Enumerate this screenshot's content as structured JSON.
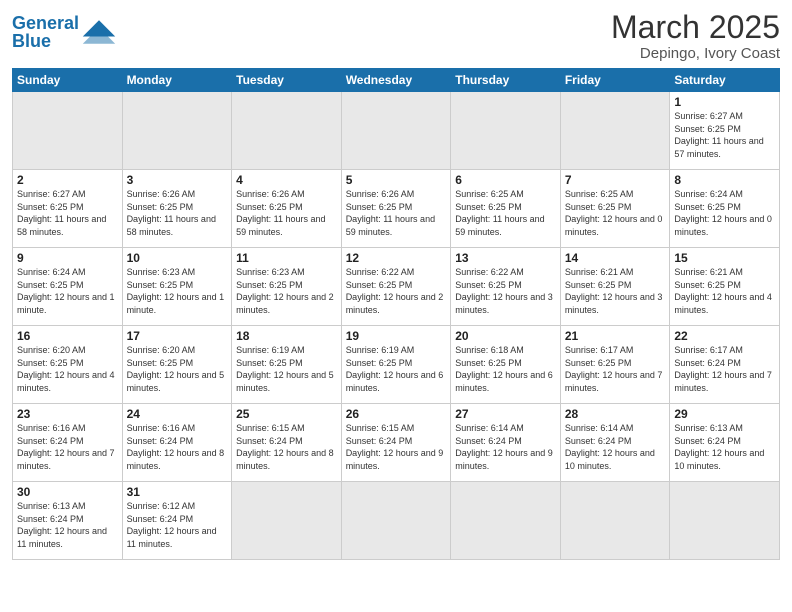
{
  "header": {
    "logo_general": "General",
    "logo_blue": "Blue",
    "month_year": "March 2025",
    "location": "Depingo, Ivory Coast"
  },
  "weekdays": [
    "Sunday",
    "Monday",
    "Tuesday",
    "Wednesday",
    "Thursday",
    "Friday",
    "Saturday"
  ],
  "weeks": [
    [
      {
        "day": "",
        "empty": true
      },
      {
        "day": "",
        "empty": true
      },
      {
        "day": "",
        "empty": true
      },
      {
        "day": "",
        "empty": true
      },
      {
        "day": "",
        "empty": true
      },
      {
        "day": "",
        "empty": true
      },
      {
        "day": "1",
        "sunrise": "6:27 AM",
        "sunset": "6:25 PM",
        "daylight": "11 hours and 57 minutes."
      }
    ],
    [
      {
        "day": "2",
        "sunrise": "6:27 AM",
        "sunset": "6:25 PM",
        "daylight": "11 hours and 58 minutes."
      },
      {
        "day": "3",
        "sunrise": "6:26 AM",
        "sunset": "6:25 PM",
        "daylight": "11 hours and 58 minutes."
      },
      {
        "day": "4",
        "sunrise": "6:26 AM",
        "sunset": "6:25 PM",
        "daylight": "11 hours and 59 minutes."
      },
      {
        "day": "5",
        "sunrise": "6:26 AM",
        "sunset": "6:25 PM",
        "daylight": "11 hours and 59 minutes."
      },
      {
        "day": "6",
        "sunrise": "6:25 AM",
        "sunset": "6:25 PM",
        "daylight": "11 hours and 59 minutes."
      },
      {
        "day": "7",
        "sunrise": "6:25 AM",
        "sunset": "6:25 PM",
        "daylight": "12 hours and 0 minutes."
      },
      {
        "day": "8",
        "sunrise": "6:24 AM",
        "sunset": "6:25 PM",
        "daylight": "12 hours and 0 minutes."
      }
    ],
    [
      {
        "day": "9",
        "sunrise": "6:24 AM",
        "sunset": "6:25 PM",
        "daylight": "12 hours and 1 minute."
      },
      {
        "day": "10",
        "sunrise": "6:23 AM",
        "sunset": "6:25 PM",
        "daylight": "12 hours and 1 minute."
      },
      {
        "day": "11",
        "sunrise": "6:23 AM",
        "sunset": "6:25 PM",
        "daylight": "12 hours and 2 minutes."
      },
      {
        "day": "12",
        "sunrise": "6:22 AM",
        "sunset": "6:25 PM",
        "daylight": "12 hours and 2 minutes."
      },
      {
        "day": "13",
        "sunrise": "6:22 AM",
        "sunset": "6:25 PM",
        "daylight": "12 hours and 3 minutes."
      },
      {
        "day": "14",
        "sunrise": "6:21 AM",
        "sunset": "6:25 PM",
        "daylight": "12 hours and 3 minutes."
      },
      {
        "day": "15",
        "sunrise": "6:21 AM",
        "sunset": "6:25 PM",
        "daylight": "12 hours and 4 minutes."
      }
    ],
    [
      {
        "day": "16",
        "sunrise": "6:20 AM",
        "sunset": "6:25 PM",
        "daylight": "12 hours and 4 minutes."
      },
      {
        "day": "17",
        "sunrise": "6:20 AM",
        "sunset": "6:25 PM",
        "daylight": "12 hours and 5 minutes."
      },
      {
        "day": "18",
        "sunrise": "6:19 AM",
        "sunset": "6:25 PM",
        "daylight": "12 hours and 5 minutes."
      },
      {
        "day": "19",
        "sunrise": "6:19 AM",
        "sunset": "6:25 PM",
        "daylight": "12 hours and 6 minutes."
      },
      {
        "day": "20",
        "sunrise": "6:18 AM",
        "sunset": "6:25 PM",
        "daylight": "12 hours and 6 minutes."
      },
      {
        "day": "21",
        "sunrise": "6:17 AM",
        "sunset": "6:25 PM",
        "daylight": "12 hours and 7 minutes."
      },
      {
        "day": "22",
        "sunrise": "6:17 AM",
        "sunset": "6:24 PM",
        "daylight": "12 hours and 7 minutes."
      }
    ],
    [
      {
        "day": "23",
        "sunrise": "6:16 AM",
        "sunset": "6:24 PM",
        "daylight": "12 hours and 7 minutes."
      },
      {
        "day": "24",
        "sunrise": "6:16 AM",
        "sunset": "6:24 PM",
        "daylight": "12 hours and 8 minutes."
      },
      {
        "day": "25",
        "sunrise": "6:15 AM",
        "sunset": "6:24 PM",
        "daylight": "12 hours and 8 minutes."
      },
      {
        "day": "26",
        "sunrise": "6:15 AM",
        "sunset": "6:24 PM",
        "daylight": "12 hours and 9 minutes."
      },
      {
        "day": "27",
        "sunrise": "6:14 AM",
        "sunset": "6:24 PM",
        "daylight": "12 hours and 9 minutes."
      },
      {
        "day": "28",
        "sunrise": "6:14 AM",
        "sunset": "6:24 PM",
        "daylight": "12 hours and 10 minutes."
      },
      {
        "day": "29",
        "sunrise": "6:13 AM",
        "sunset": "6:24 PM",
        "daylight": "12 hours and 10 minutes."
      }
    ],
    [
      {
        "day": "30",
        "sunrise": "6:13 AM",
        "sunset": "6:24 PM",
        "daylight": "12 hours and 11 minutes."
      },
      {
        "day": "31",
        "sunrise": "6:12 AM",
        "sunset": "6:24 PM",
        "daylight": "12 hours and 11 minutes."
      },
      {
        "day": "",
        "empty": true
      },
      {
        "day": "",
        "empty": true
      },
      {
        "day": "",
        "empty": true
      },
      {
        "day": "",
        "empty": true
      },
      {
        "day": "",
        "empty": true
      }
    ]
  ]
}
